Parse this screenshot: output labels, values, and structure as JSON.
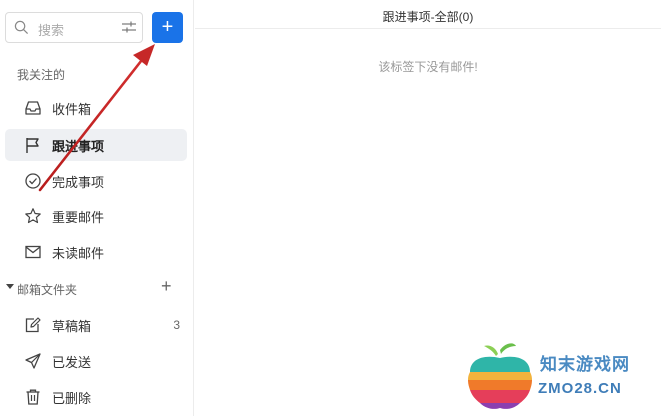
{
  "search": {
    "placeholder": "搜索",
    "icon": "search-icon",
    "filter_icon": "filter-sliders-icon"
  },
  "compose": {
    "label": "+",
    "color": "#1a73e8"
  },
  "sidebar": {
    "starred_title": "我关注的",
    "items": [
      {
        "label": "收件箱",
        "icon": "inbox-icon"
      },
      {
        "label": "跟进事项",
        "icon": "flag-icon",
        "active": true
      },
      {
        "label": "完成事项",
        "icon": "check-circle-icon"
      },
      {
        "label": "重要邮件",
        "icon": "star-icon"
      },
      {
        "label": "未读邮件",
        "icon": "envelope-icon"
      }
    ],
    "folders_title": "邮箱文件夹",
    "folders_add": "+",
    "folders": [
      {
        "label": "草稿箱",
        "icon": "draft-edit-icon",
        "count": "3"
      },
      {
        "label": "已发送",
        "icon": "send-icon"
      },
      {
        "label": "已删除",
        "icon": "trash-icon"
      }
    ]
  },
  "main": {
    "title": "跟进事项-全部(0)",
    "empty_message": "该标签下没有邮件!"
  },
  "watermark": {
    "cn": "知末游戏网",
    "en": "ZMO28.CN"
  },
  "annotation": {
    "arrow_color": "#c62828"
  }
}
